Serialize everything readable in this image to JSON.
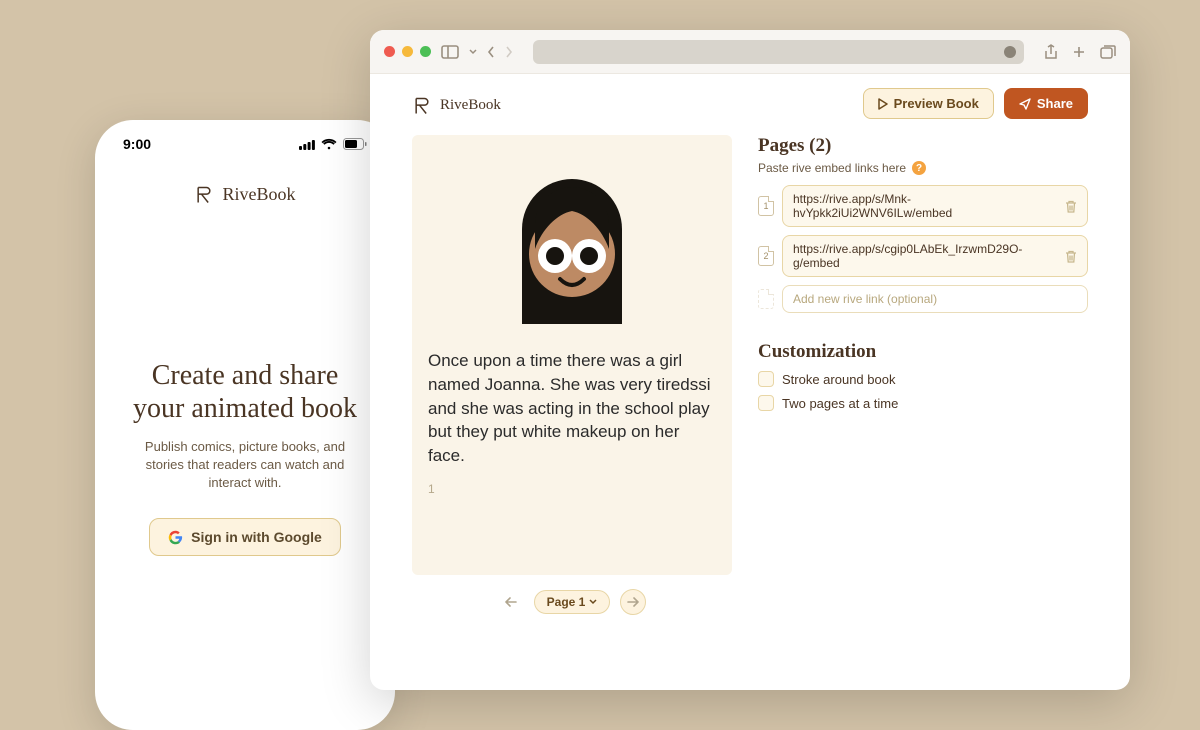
{
  "brand": "RiveBook",
  "phone": {
    "time": "9:00",
    "headline": "Create and share your animated book",
    "subhead": "Publish comics, picture books, and stories that readers can watch and interact with.",
    "google_button": "Sign in with Google"
  },
  "browser": {
    "preview_label": "Preview Book",
    "share_label": "Share",
    "story_text": "Once upon a time there was a girl named Joanna. She was very tiredssi and she was acting in the school play but they put white makeup on her face.",
    "page_number": "1",
    "pager_label": "Page 1",
    "pages": {
      "title": "Pages (2)",
      "hint": "Paste rive embed links here",
      "items": [
        {
          "index": "1",
          "url": "https://rive.app/s/Mnk-hvYpkk2iUi2WNV6ILw/embed"
        },
        {
          "index": "2",
          "url": "https://rive.app/s/cgip0LAbEk_IrzwmD29O-g/embed"
        }
      ],
      "add_placeholder": "Add new rive link (optional)"
    },
    "customization": {
      "title": "Customization",
      "stroke_label": "Stroke around book",
      "two_pages_label": "Two pages at a time"
    }
  }
}
